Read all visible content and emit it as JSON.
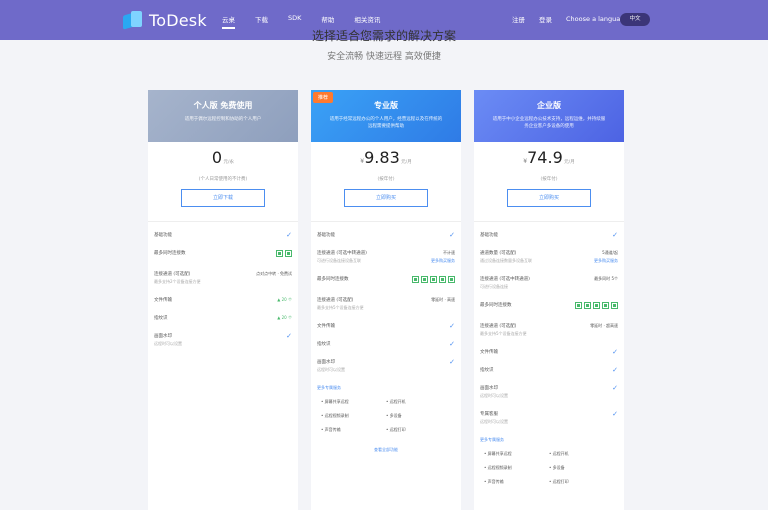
{
  "header": {
    "logo_text": "ToDesk",
    "nav": [
      "云桌",
      "下载",
      "SDK",
      "帮助",
      "相关资讯"
    ],
    "right_nav": [
      "注册",
      "登录",
      "Choose a language"
    ],
    "dark_button": "中文"
  },
  "page": {
    "title": "选择适合您需求的解决方案",
    "subtitle": "安全流畅 快速远程 高效便捷"
  },
  "cards": [
    {
      "title": "个人版 免费使用",
      "desc": "适用于偶尔远程控制和协助的个人用户",
      "ribbon": "",
      "price": "0",
      "price_symbol": "",
      "price_unit": "元/永",
      "price_note": "(个人日常使用的不计费)",
      "cta": "立即下载",
      "rows": [
        {
          "label": "基础功能",
          "type": "check"
        },
        {
          "label": "最多同时连接数",
          "type": "squares",
          "count": 2
        },
        {
          "label": "连接通道 (可选配)",
          "sub": "最多支持2个设备连接方便",
          "type": "value",
          "value": "点对点中转 · 免费试",
          "link": ""
        },
        {
          "label": "文件传输",
          "type": "green",
          "value": "▲ 20 个"
        },
        {
          "label": "指纹识",
          "type": "green",
          "value": "▲ 20 个"
        },
        {
          "label": "画面水印",
          "sub": "远程时可以设置",
          "type": "check"
        }
      ],
      "features": [],
      "bottom_link": ""
    },
    {
      "title": "专业版",
      "desc": "适用于经常远程办公的个人用户，经营远程以及在传统的远程需要提供帮助",
      "ribbon": "推荐",
      "price": "9.83",
      "price_symbol": "¥",
      "price_unit": "元/月",
      "price_note": "(按年付)",
      "cta": "立即购买",
      "rows": [
        {
          "label": "基础功能",
          "type": "check"
        },
        {
          "label": "连接通道 (可选中转通道)",
          "sub": "可进行设备连接设备互联",
          "type": "value",
          "value": "不计速",
          "link": "更多购买服务"
        },
        {
          "label": "最多同时连接数",
          "type": "squares",
          "count": 5
        },
        {
          "label": "连接通道 (可选配)",
          "sub": "最多支持5个设备连接方便",
          "type": "value",
          "value": "零延时 · 高速",
          "link": ""
        },
        {
          "label": "文件传输",
          "type": "check"
        },
        {
          "label": "指纹识",
          "type": "check"
        },
        {
          "label": "画面水印",
          "sub": "远程时可以设置",
          "type": "check"
        }
      ],
      "features_title": "更多专属服务",
      "features": [
        "屏幕共享远程",
        "远程开机",
        "远程视频录制",
        "多设备",
        "声音传输",
        "远程打印"
      ],
      "bottom_link": "查看全部功能"
    },
    {
      "title": "企业版",
      "desc": "适用于中小企业远程办公技术支持，远程运维，并持续服务企业客户多设备的使用",
      "ribbon": "",
      "price": "74.9",
      "price_symbol": "¥",
      "price_unit": "元/月",
      "price_note": "(按年付)",
      "cta": "立即购买",
      "rows": [
        {
          "label": "基础功能",
          "type": "check"
        },
        {
          "label": "通道数量 (可选配)",
          "sub": "通过设备连接数量多设备互联",
          "type": "value",
          "value": "5通道/起",
          "link": "更多购买服务"
        },
        {
          "label": "连接通道 (可选中转通道)",
          "sub": "可进行设备连接",
          "type": "value",
          "value": "最多同时 5个",
          "link": ""
        },
        {
          "label": "最多同时连接数",
          "type": "squares",
          "count": 5
        },
        {
          "label": "连接通道 (可选配)",
          "sub": "最多支持5个设备连接方便",
          "type": "value",
          "value": "零延时 · 超高速",
          "link": ""
        },
        {
          "label": "文件传输",
          "type": "check"
        },
        {
          "label": "指纹识",
          "type": "check"
        },
        {
          "label": "画面水印",
          "sub": "远程时可以设置",
          "type": "check"
        },
        {
          "label": "专属客服",
          "sub": "远程时可以设置",
          "type": "check"
        }
      ],
      "features_title": "更多专属服务",
      "features": [
        "屏幕共享远程",
        "远程开机",
        "远程视频录制",
        "多设备",
        "声音传输",
        "远程打印"
      ],
      "bottom_link": ""
    }
  ]
}
